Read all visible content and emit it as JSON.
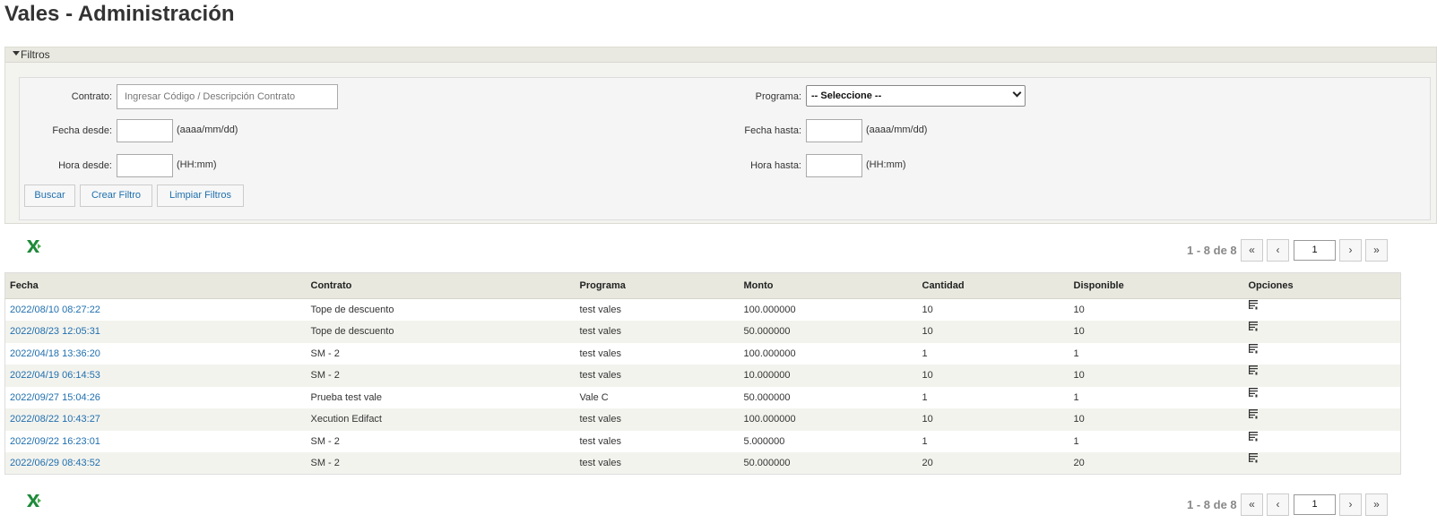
{
  "page": {
    "title": "Vales - Administración"
  },
  "filters": {
    "header": "Filtros",
    "contrato_label": "Contrato:",
    "contrato_placeholder": "Ingresar Código / Descripción Contrato",
    "programa_label": "Programa:",
    "programa_selected": "-- Seleccione --",
    "fecha_desde_label": "Fecha desde:",
    "fecha_hasta_label": "Fecha hasta:",
    "fecha_format": "(aaaa/mm/dd)",
    "hora_desde_label": "Hora desde:",
    "hora_hasta_label": "Hora hasta:",
    "hora_format": "(HH:mm)",
    "buttons": {
      "buscar": "Buscar",
      "crear": "Crear Filtro",
      "limpiar": "Limpiar Filtros"
    }
  },
  "pager": {
    "info": "1 - 8 de 8",
    "first": "«",
    "prev": "‹",
    "page": "1",
    "next": "›",
    "last": "»"
  },
  "table": {
    "headers": [
      "Fecha",
      "Contrato",
      "Programa",
      "Monto",
      "Cantidad",
      "Disponible",
      "Opciones"
    ],
    "rows": [
      [
        "2022/08/10 08:27:22",
        "Tope de descuento",
        "test vales",
        "100.000000",
        "10",
        "10"
      ],
      [
        "2022/08/23 12:05:31",
        "Tope de descuento",
        "test vales",
        "50.000000",
        "10",
        "10"
      ],
      [
        "2022/04/18 13:36:20",
        "SM - 2",
        "test vales",
        "100.000000",
        "1",
        "1"
      ],
      [
        "2022/04/19 06:14:53",
        "SM - 2",
        "test vales",
        "10.000000",
        "10",
        "10"
      ],
      [
        "2022/09/27 15:04:26",
        "Prueba test vale",
        "Vale C",
        "50.000000",
        "1",
        "1"
      ],
      [
        "2022/08/22 10:43:27",
        "Xecution Edifact",
        "test vales",
        "100.000000",
        "10",
        "10"
      ],
      [
        "2022/09/22 16:23:01",
        "SM - 2",
        "test vales",
        "5.000000",
        "1",
        "1"
      ],
      [
        "2022/06/29 08:43:52",
        "SM - 2",
        "test vales",
        "50.000000",
        "20",
        "20"
      ]
    ]
  },
  "icons": {
    "export": "excel-export-icon",
    "option": "details-list-icon"
  },
  "colors": {
    "link": "#1f6fae",
    "header_bg": "#e8e8df",
    "excel_green": "#1e8a3a"
  }
}
